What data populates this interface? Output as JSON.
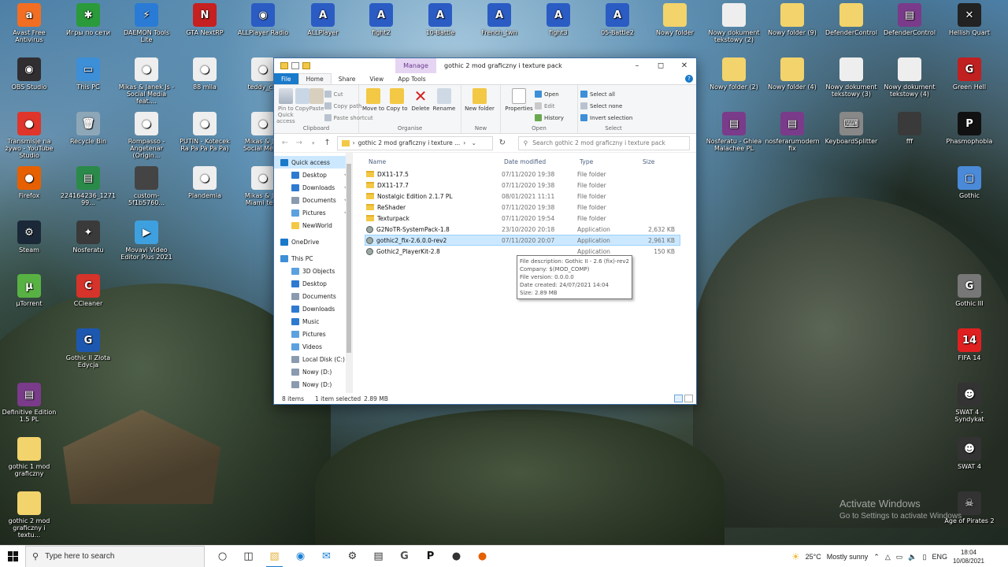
{
  "desktop_icons": [
    {
      "label": "Avast Free Antivirus",
      "color": "#f26e22",
      "glyph": "a"
    },
    {
      "label": "Игры по сети",
      "color": "#2a9a3a",
      "glyph": "✱"
    },
    {
      "label": "DAEMON Tools Lite",
      "color": "#2a7bd6",
      "glyph": "⚡"
    },
    {
      "label": "GTA NextRP",
      "color": "#c62020",
      "glyph": "N"
    },
    {
      "label": "ALLPlayer Radio",
      "color": "#2b5cc4",
      "glyph": "◉"
    },
    {
      "label": "ALLPlayer",
      "color": "#2b5cc4",
      "glyph": "A"
    },
    {
      "label": "fight2",
      "color": "#2b5cc4",
      "glyph": "A"
    },
    {
      "label": "10-Battle",
      "color": "#2b5cc4",
      "glyph": "A"
    },
    {
      "label": "French_twn",
      "color": "#2b5cc4",
      "glyph": "A"
    },
    {
      "label": "fight3",
      "color": "#2b5cc4",
      "glyph": "A"
    },
    {
      "label": "05-Battle2",
      "color": "#2b5cc4",
      "glyph": "A"
    },
    {
      "label": "Nowy folder",
      "color": "#f3d36b",
      "glyph": ""
    },
    {
      "label": "Nowy dokument tekstowy (2)",
      "color": "#eeeeee",
      "glyph": ""
    },
    {
      "label": "Nowy folder (9)",
      "color": "#f3d36b",
      "glyph": ""
    },
    {
      "label": "DefenderControl",
      "color": "#f3d36b",
      "glyph": ""
    },
    {
      "label": "DefenderControl",
      "color": "#7a3b8a",
      "glyph": "▤"
    },
    {
      "label": "Hellish Quart",
      "color": "#222222",
      "glyph": "✕"
    },
    {
      "label": "OBS Studio",
      "color": "#302e31",
      "glyph": "◉"
    },
    {
      "label": "This PC",
      "color": "#3d8fd8",
      "glyph": "▭"
    },
    {
      "label": "Mikas & Janek Js - Social Media feat....",
      "color": "#eeeeee",
      "glyph": "●"
    },
    {
      "label": "88 mila",
      "color": "#eeeeee",
      "glyph": "●"
    },
    {
      "label": "teddy_c...",
      "color": "#eeeeee",
      "glyph": "●"
    },
    {
      "label": "Nowy folder (2)",
      "color": "#f3d36b",
      "glyph": ""
    },
    {
      "label": "Nowy folder (4)",
      "color": "#f3d36b",
      "glyph": ""
    },
    {
      "label": "Nowy dokument tekstowy (3)",
      "color": "#eeeeee",
      "glyph": ""
    },
    {
      "label": "Nowy dokument tekstowy (4)",
      "color": "#eeeeee",
      "glyph": ""
    },
    {
      "label": "Green Hell",
      "color": "#c02020",
      "glyph": "G"
    },
    {
      "label": "Transmisje na żywo - YouTube Studio",
      "color": "#e0352a",
      "glyph": "●"
    },
    {
      "label": "Recycle Bin",
      "color": "#8ea7b8",
      "glyph": "🗑"
    },
    {
      "label": "Rompasso - Angetenar (Origin...",
      "color": "#eeeeee",
      "glyph": "●"
    },
    {
      "label": "PUTIN - Kotecek Ra Pa Pa Pa Pa)",
      "color": "#eeeeee",
      "glyph": "●"
    },
    {
      "label": "Mikas & Jan Social Media",
      "color": "#eeeeee",
      "glyph": "●"
    },
    {
      "label": "Nosferatu - Ghiea Malachee PL",
      "color": "#7a3b8a",
      "glyph": "▤"
    },
    {
      "label": "nosferarumodernfix",
      "color": "#7a3b8a",
      "glyph": "▤"
    },
    {
      "label": "KeyboardSplitter",
      "color": "#888888",
      "glyph": "⌨"
    },
    {
      "label": "fff",
      "color": "#3a3a3a",
      "glyph": ""
    },
    {
      "label": "Phasmophobia",
      "color": "#111111",
      "glyph": "P"
    },
    {
      "label": "Firefox",
      "color": "#e66000",
      "glyph": "●"
    },
    {
      "label": "224164236_127199...",
      "color": "#2a8a4a",
      "glyph": "▤"
    },
    {
      "label": "custom-5f1b5760...",
      "color": "#444444",
      "glyph": ""
    },
    {
      "label": "Plandemia",
      "color": "#eeeeee",
      "glyph": "●"
    },
    {
      "label": "Mikas & Jan Miami tego",
      "color": "#eeeeee",
      "glyph": "●"
    },
    {
      "label": "Gothic",
      "color": "#4a8ad8",
      "glyph": "▢"
    },
    {
      "label": "Steam",
      "color": "#1b2838",
      "glyph": "⚙"
    },
    {
      "label": "Nosferatu",
      "color": "#3a3a3a",
      "glyph": "✦"
    },
    {
      "label": "Movavi Video Editor Plus 2021",
      "color": "#3fa0e0",
      "glyph": "▶"
    },
    {
      "label": "µTorrent",
      "color": "#58b243",
      "glyph": "µ"
    },
    {
      "label": "CCleaner",
      "color": "#d6332a",
      "glyph": "C"
    },
    {
      "label": "Gothic III",
      "color": "#777777",
      "glyph": "G"
    },
    {
      "label": "Gothic II Złota Edycja",
      "color": "#1d58b0",
      "glyph": "G"
    },
    {
      "label": "FIFA 14",
      "color": "#e02020",
      "glyph": "14"
    },
    {
      "label": "Definitive Edition 1.5 PL",
      "color": "#7a3b8a",
      "glyph": "▤"
    },
    {
      "label": "SWAT 4 - Syndykat",
      "color": "#333333",
      "glyph": "☻"
    },
    {
      "label": "gothic 1 mod graficzny",
      "color": "#f3d36b",
      "glyph": ""
    },
    {
      "label": "SWAT 4",
      "color": "#333333",
      "glyph": "☻"
    },
    {
      "label": "gothic 2 mod graficzny i textu...",
      "color": "#f3d36b",
      "glyph": ""
    },
    {
      "label": "Age of Pirates 2",
      "color": "#333333",
      "glyph": "☠"
    }
  ],
  "explorer": {
    "title": "gothic 2 mod graficzny i texture pack",
    "manage_tab": "Manage",
    "tabs": {
      "file": "File",
      "home": "Home",
      "share": "Share",
      "view": "View",
      "app_tools": "App Tools"
    },
    "ribbon": {
      "pin_to_quick": "Pin to Quick access",
      "copy": "Copy",
      "paste": "Paste",
      "cut": "Cut",
      "copy_path": "Copy path",
      "paste_shortcut": "Paste shortcut",
      "clipboard": "Clipboard",
      "move_to": "Move to",
      "copy_to": "Copy to",
      "delete": "Delete",
      "rename": "Rename",
      "organise": "Organise",
      "new_folder": "New folder",
      "new": "New",
      "properties": "Properties",
      "open": "Open",
      "edit": "Edit",
      "history": "History",
      "open_group": "Open",
      "select_all": "Select all",
      "select_none": "Select none",
      "invert_selection": "Invert selection",
      "select": "Select"
    },
    "path": "gothic 2 mod graficzny i texture ...",
    "search_placeholder": "Search gothic 2 mod graficzny i texture pack",
    "nav": [
      {
        "label": "Quick access",
        "color": "#1979ca",
        "sel": true,
        "indent": 0,
        "pin": false
      },
      {
        "label": "Desktop",
        "color": "#2e7ad1",
        "sel": false,
        "indent": 1,
        "pin": true
      },
      {
        "label": "Downloads",
        "color": "#2e7ad1",
        "sel": false,
        "indent": 1,
        "pin": true
      },
      {
        "label": "Documents",
        "color": "#8a9bb0",
        "sel": false,
        "indent": 1,
        "pin": true
      },
      {
        "label": "Pictures",
        "color": "#5ba1e0",
        "sel": false,
        "indent": 1,
        "pin": true
      },
      {
        "label": "NewWorld",
        "color": "#f3c844",
        "sel": false,
        "indent": 1,
        "pin": false
      },
      {
        "label": "OneDrive",
        "color": "#1979ca",
        "sel": false,
        "indent": 0,
        "pin": false
      },
      {
        "label": "This PC",
        "color": "#3d8fd8",
        "sel": false,
        "indent": 0,
        "pin": false
      },
      {
        "label": "3D Objects",
        "color": "#5ba1e0",
        "sel": false,
        "indent": 1,
        "pin": false
      },
      {
        "label": "Desktop",
        "color": "#2e7ad1",
        "sel": false,
        "indent": 1,
        "pin": false
      },
      {
        "label": "Documents",
        "color": "#8a9bb0",
        "sel": false,
        "indent": 1,
        "pin": false
      },
      {
        "label": "Downloads",
        "color": "#2e7ad1",
        "sel": false,
        "indent": 1,
        "pin": false
      },
      {
        "label": "Music",
        "color": "#2e7ad1",
        "sel": false,
        "indent": 1,
        "pin": false
      },
      {
        "label": "Pictures",
        "color": "#5ba1e0",
        "sel": false,
        "indent": 1,
        "pin": false
      },
      {
        "label": "Videos",
        "color": "#5ba1e0",
        "sel": false,
        "indent": 1,
        "pin": false
      },
      {
        "label": "Local Disk (C:)",
        "color": "#8a9bb0",
        "sel": false,
        "indent": 1,
        "pin": false
      },
      {
        "label": "Nowy (D:)",
        "color": "#8a9bb0",
        "sel": false,
        "indent": 1,
        "pin": false
      },
      {
        "label": "Nowy (D:)",
        "color": "#8a9bb0",
        "sel": false,
        "indent": 1,
        "pin": false
      }
    ],
    "columns": {
      "name": "Name",
      "date": "Date modified",
      "type": "Type",
      "size": "Size"
    },
    "files": [
      {
        "name": "DX11-17.5",
        "date": "07/11/2020 19:38",
        "type": "File folder",
        "size": "",
        "kind": "folder",
        "sel": false
      },
      {
        "name": "DX11-17.7",
        "date": "07/11/2020 19:38",
        "type": "File folder",
        "size": "",
        "kind": "folder",
        "sel": false
      },
      {
        "name": "Nostalgic Edition 2.1.7 PL",
        "date": "08/01/2021 11:11",
        "type": "File folder",
        "size": "",
        "kind": "folder",
        "sel": false
      },
      {
        "name": "ReShader",
        "date": "07/11/2020 19:38",
        "type": "File folder",
        "size": "",
        "kind": "folder",
        "sel": false
      },
      {
        "name": "Texturpack",
        "date": "07/11/2020 19:54",
        "type": "File folder",
        "size": "",
        "kind": "folder",
        "sel": false
      },
      {
        "name": "G2NoTR-SystemPack-1.8",
        "date": "23/10/2020 20:18",
        "type": "Application",
        "size": "2,632 KB",
        "kind": "app",
        "sel": false
      },
      {
        "name": "gothic2_fix-2.6.0.0-rev2",
        "date": "07/11/2020 20:07",
        "type": "Application",
        "size": "2,961 KB",
        "kind": "app",
        "sel": true
      },
      {
        "name": "Gothic2_PlayerKit-2.8",
        "date": "",
        "type": "Application",
        "size": "150 KB",
        "kind": "app",
        "sel": false
      }
    ],
    "tooltip": [
      "File description: Gothic II - 2.6 (fix)-rev2",
      "Company: $(MOD_COMP)",
      "File version: 0.0.0.0",
      "Date created: 24/07/2021 14:04",
      "Size: 2.89 MB"
    ],
    "status": {
      "items": "8 items",
      "selected": "1 item selected",
      "size": "2.89 MB"
    }
  },
  "activate": {
    "line1": "Activate Windows",
    "line2": "Go to Settings to activate Windows"
  },
  "taskbar": {
    "search_placeholder": "Type here to search",
    "weather_temp": "25°C",
    "weather_text": "Mostly sunny",
    "lang": "ENG",
    "time": "18:04",
    "date": "10/08/2021"
  }
}
